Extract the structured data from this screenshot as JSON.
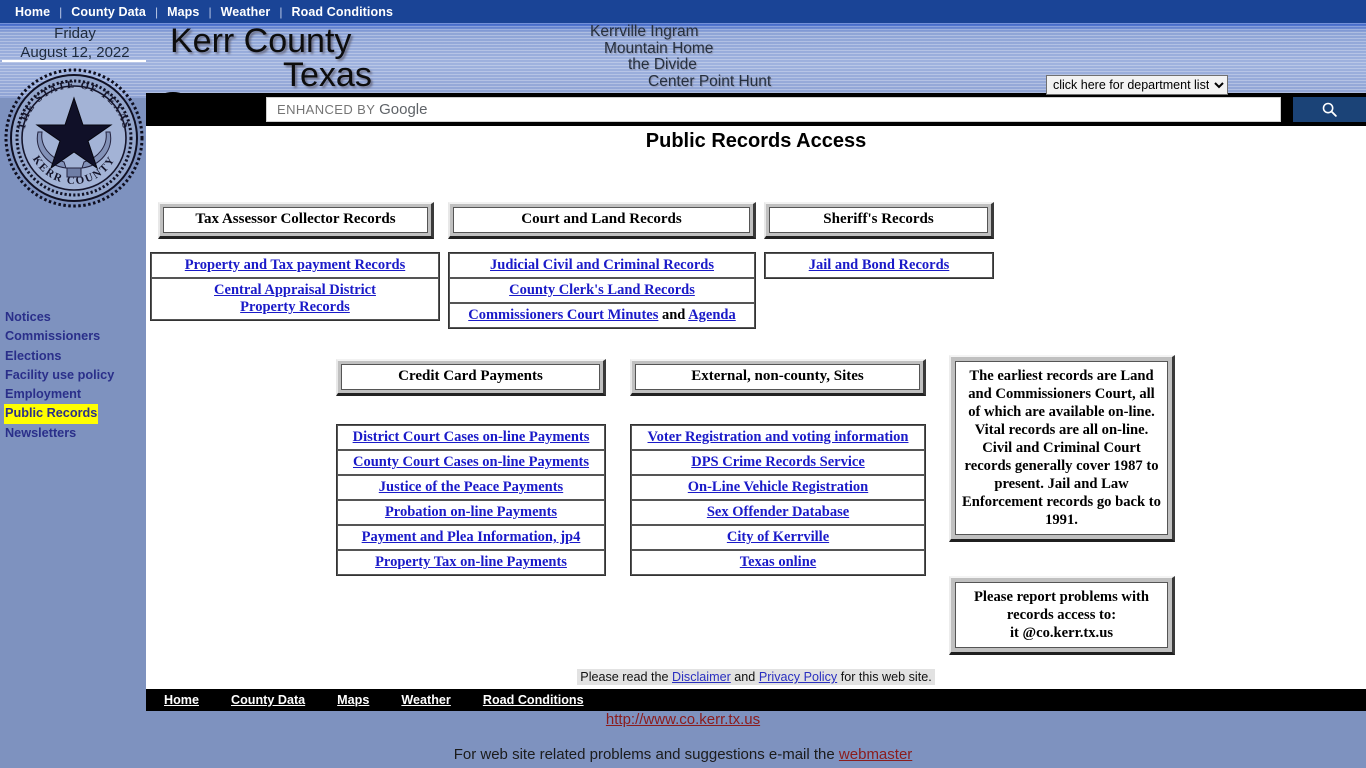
{
  "topnav": {
    "items": [
      "Home",
      "County Data",
      "Maps",
      "Weather",
      "Road Conditions"
    ],
    "separator": "|"
  },
  "header": {
    "date_day": "Friday",
    "date_full": "August 12, 2022",
    "title_line1": "Kerr County",
    "title_line2": "Texas",
    "cities": [
      "Kerrville  Ingram",
      "Mountain Home",
      "the Divide",
      "Center Point  Hunt"
    ],
    "seal": {
      "outer_text": "THE STATE OF TEXAS",
      "bottom_text": "KERR COUNTY"
    },
    "department_select": {
      "selected": "click here for department list",
      "options": [
        "click here for department list"
      ]
    }
  },
  "search": {
    "placeholder_prefix": "ENHANCED BY",
    "placeholder_brand": "Google",
    "value": "",
    "button_icon": "search-icon"
  },
  "page": {
    "title": "Public Records Access"
  },
  "sidebar": {
    "items": [
      {
        "label": "Notices",
        "highlighted": false
      },
      {
        "label": "Commissioners",
        "highlighted": false
      },
      {
        "label": "Elections",
        "highlighted": false
      },
      {
        "label": " Facility use policy",
        "highlighted": false
      },
      {
        "label": "Employment",
        "highlighted": false
      },
      {
        "label": "Public Records",
        "highlighted": true
      },
      {
        "label": "Newsletters",
        "highlighted": false
      }
    ],
    "highlight_color": "#ffff00"
  },
  "sections": {
    "tax": {
      "header": "Tax Assessor Collector Records",
      "links": [
        "Property and Tax payment Records",
        "Central Appraisal District\nProperty Records"
      ]
    },
    "court": {
      "header": "Court and Land Records",
      "links": [
        "Judicial Civil and Criminal Records",
        "County Clerk's Land Records"
      ],
      "minutes_link": "Commissioners Court Minutes",
      "minutes_conj": "and",
      "agenda_link": "Agenda"
    },
    "sheriff": {
      "header": "Sheriff's Records",
      "links": [
        "Jail and Bond Records"
      ]
    },
    "credit": {
      "header": "Credit Card Payments",
      "links": [
        "District Court Cases on-line Payments",
        "County Court Cases on-line Payments",
        "Justice of the Peace Payments",
        "Probation on-line Payments",
        "Payment and Plea Information, jp4",
        "Property Tax on-line Payments"
      ]
    },
    "external": {
      "header": "External, non-county, Sites",
      "links": [
        "Voter Registration and voting information",
        "DPS Crime Records Service",
        "On-Line Vehicle Registration",
        "Sex Offender Database",
        "City of Kerrville",
        "Texas online"
      ]
    }
  },
  "notes": {
    "records_info": "The earliest records are Land and Commissioners Court, all of which are available on-line. Vital records are all on-line. Civil and Criminal Court records generally cover 1987 to present. Jail and Law Enforcement records go back to 1991.",
    "report_line1": "Please report problems with",
    "report_line2": "records access to:",
    "report_email": "it @co.kerr.tx.us"
  },
  "footer": {
    "disclaimer_pre": "Please read the",
    "disclaimer_link1": "Disclaimer",
    "disclaimer_mid": "and",
    "disclaimer_link2": "Privacy Policy",
    "disclaimer_post": "for this web site.",
    "nav": [
      "Home",
      "County Data",
      "Maps",
      "Weather",
      "Road Conditions"
    ],
    "site_url": "http://www.co.kerr.tx.us",
    "email_text": "For web site related problems and suggestions e-mail the",
    "email_link": "webmaster"
  },
  "colors": {
    "nav_blue": "#1a4496",
    "sidebar_blue": "#7e92bf",
    "link_blue": "#1a1ac8",
    "footer_red": "#8b1c1c"
  }
}
